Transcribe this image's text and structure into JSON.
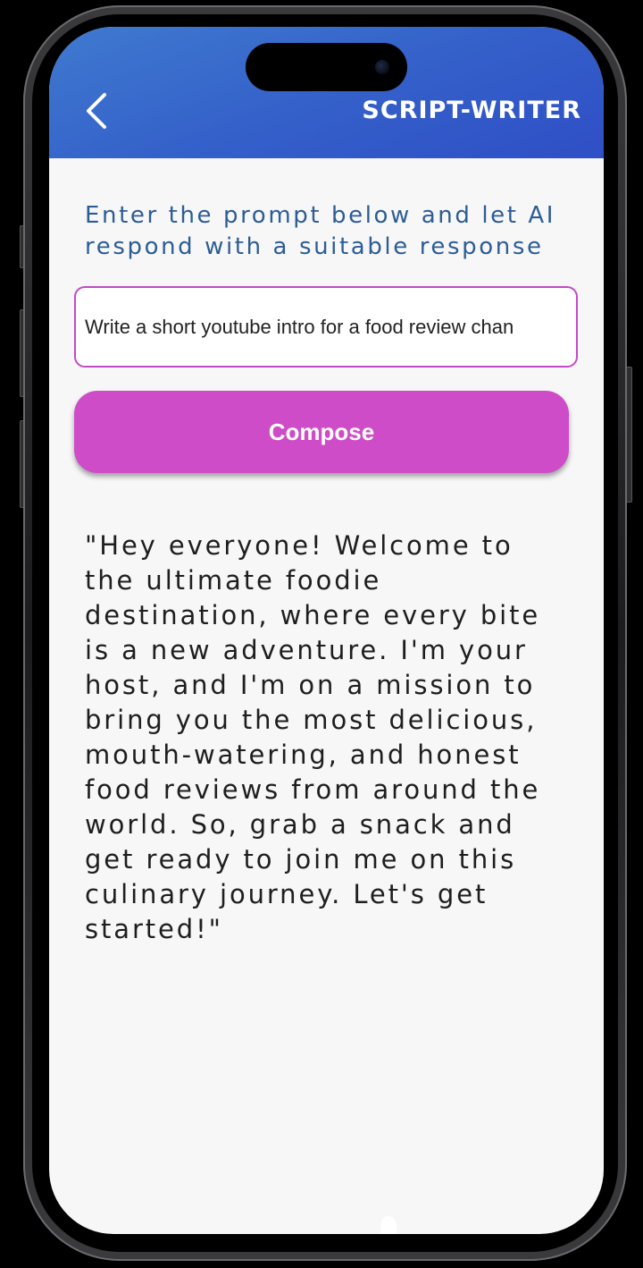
{
  "appbar": {
    "title": "SCRIPT-WRITER",
    "back_icon": "chevron-left-icon",
    "gradient_colors": [
      "#3f7ad0",
      "#2f4fc6"
    ]
  },
  "main": {
    "instruction": "Enter the prompt below and let AI respond with a suitable response",
    "prompt_input": {
      "value": "Write a short youtube intro for a food review chan",
      "placeholder": ""
    },
    "compose_button_label": "Compose",
    "response_text": "\"Hey everyone! Welcome to the ultimate foodie destination, where every bite is a new adventure. I'm your host, and I'm on a mission to bring you the most delicious, mouth-watering, and honest food reviews from around the world. So, grab a snack and get ready to join me on this culinary journey. Let's get started!\""
  },
  "colors": {
    "accent": "#cf4cc8",
    "instruction_text": "#2d5d96",
    "background": "#f7f7f7"
  }
}
